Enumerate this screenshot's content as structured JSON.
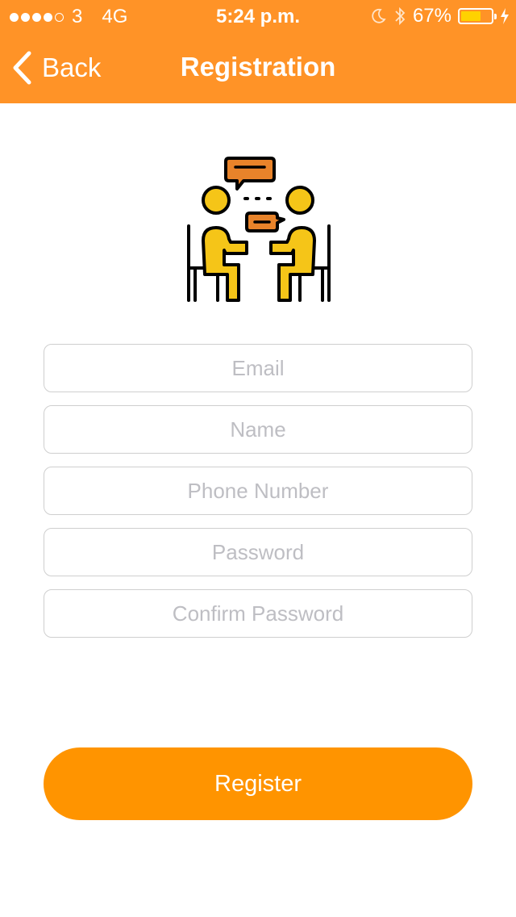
{
  "status_bar": {
    "carrier": "3",
    "network": "4G",
    "time": "5:24 p.m.",
    "battery_percent": "67%",
    "battery_level": 0.67,
    "signal_bars_filled": 4,
    "signal_bars_total": 5
  },
  "nav": {
    "back_label": "Back",
    "title": "Registration"
  },
  "form": {
    "email_placeholder": "Email",
    "name_placeholder": "Name",
    "phone_placeholder": "Phone Number",
    "password_placeholder": "Password",
    "confirm_password_placeholder": "Confirm Password"
  },
  "register_label": "Register",
  "colors": {
    "header": "#FF9327",
    "button": "#FF9400",
    "battery_fill": "#FFD200",
    "illustration_yellow": "#F5C518",
    "illustration_orange": "#E8832A"
  },
  "icons": {
    "illustration": "two-people-meeting-illustration"
  }
}
